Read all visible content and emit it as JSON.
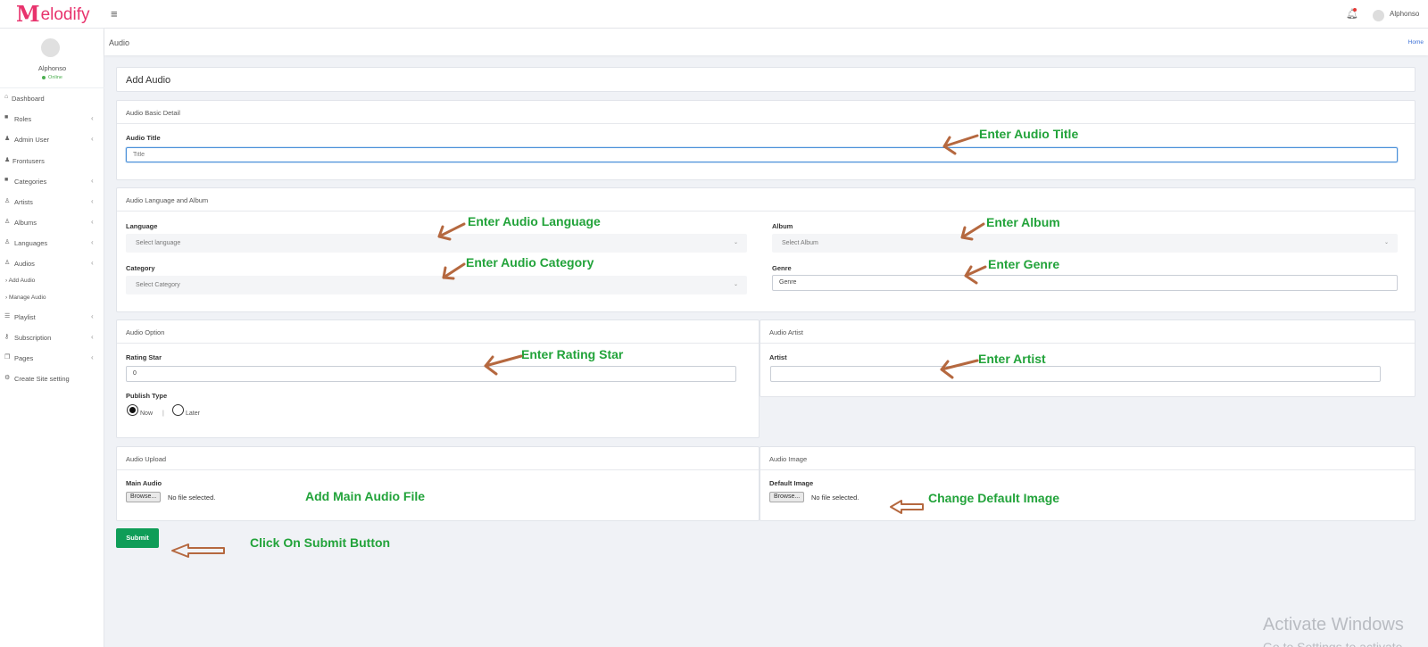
{
  "app": {
    "logo_m": "M",
    "logo_rest": "elodify",
    "user_name": "Alphonso"
  },
  "sidebar": {
    "user_name": "Alphonso",
    "status": "Online",
    "items": [
      {
        "label": "Dashboard",
        "icon": "home-icon"
      },
      {
        "label": "Roles",
        "icon": "briefcase-icon"
      },
      {
        "label": "Admin User",
        "icon": "users-icon"
      },
      {
        "label": "Frontusers",
        "icon": "users-icon"
      },
      {
        "label": "Categories",
        "icon": "briefcase-icon"
      },
      {
        "label": "Artists",
        "icon": "person-icon"
      },
      {
        "label": "Albums",
        "icon": "person-icon"
      },
      {
        "label": "Languages",
        "icon": "person-icon"
      },
      {
        "label": "Audios",
        "icon": "person-icon"
      },
      {
        "label": "Playlist",
        "icon": "list-icon"
      },
      {
        "label": "Subscription",
        "icon": "key-icon"
      },
      {
        "label": "Pages",
        "icon": "pages-icon"
      },
      {
        "label": "Create Site setting",
        "icon": "gear-icon"
      }
    ],
    "sub_items": [
      "› Add Audio",
      "› Manage Audio"
    ]
  },
  "header": {
    "title": "Audio",
    "home": "Home"
  },
  "form": {
    "page_title": "Add Audio",
    "basic": {
      "heading": "Audio Basic Detail",
      "title_label": "Audio Title",
      "title_placeholder": "Title"
    },
    "lang_album": {
      "heading": "Audio Language and Album",
      "language_label": "Language",
      "language_value": "Select language",
      "album_label": "Album",
      "album_value": "Select Album",
      "category_label": "Category",
      "category_value": "Select Category",
      "genre_label": "Genre",
      "genre_value": "Genre"
    },
    "option": {
      "heading": "Audio Option",
      "rating_label": "Rating Star",
      "rating_value": "0",
      "publish_label": "Publish Type",
      "publish_now": "Now",
      "publish_sep": "|",
      "publish_later": "Later",
      "publish_selected": "Now"
    },
    "artist": {
      "heading": "Audio Artist",
      "artist_label": "Artist",
      "artist_value": ""
    },
    "upload": {
      "heading": "Audio Upload",
      "main_label": "Main Audio",
      "browse": "Browse...",
      "no_file": "No file selected."
    },
    "image": {
      "heading": "Audio Image",
      "default_label": "Default Image",
      "browse": "Browse...",
      "no_file": "No file selected."
    },
    "submit": "Submit"
  },
  "annotations": {
    "title": "Enter Audio Title",
    "language": "Enter Audio Language",
    "album": "Enter Album",
    "category": "Enter Audio Category",
    "genre": "Enter Genre",
    "rating": "Enter Rating Star",
    "artist": "Enter Artist",
    "main_audio": "Add Main Audio File",
    "default_image": "Change Default Image",
    "submit": "Click On Submit Button"
  },
  "watermark": {
    "line1": "Activate Windows",
    "line2": "Go to Settings to activate Windows."
  },
  "colors": {
    "brand": "#e8336d",
    "annotation": "#22a33a",
    "arrow": "#b5683f",
    "submit": "#0f9d58",
    "online": "#4caf50"
  }
}
